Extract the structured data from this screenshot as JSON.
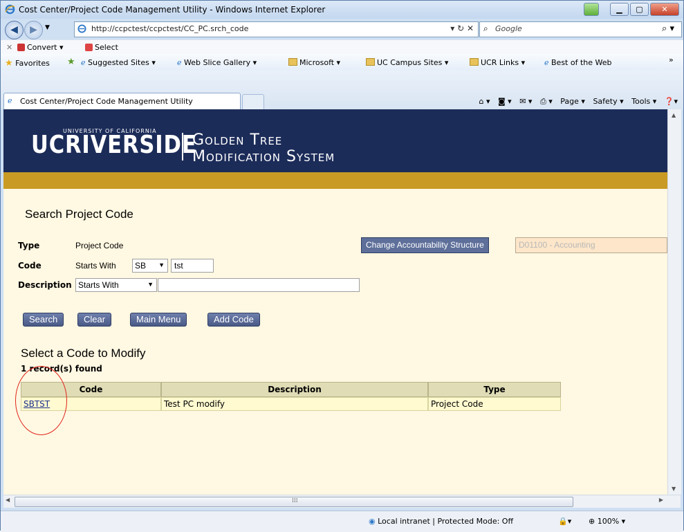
{
  "window": {
    "title": "Cost Center/Project Code Management Utility - Windows Internet Explorer"
  },
  "address_bar": {
    "url": "http://ccpctest/ccpctest/CC_PC.srch_code",
    "search_placeholder": "Google"
  },
  "toolbar": {
    "convert_label": "Convert ▾",
    "select_label": "Select"
  },
  "favorites": {
    "favorites_label": "Favorites",
    "items": [
      "Suggested Sites ▾",
      "Web Slice Gallery ▾",
      "Microsoft ▾",
      "UC Campus Sites ▾",
      "UCR Links ▾",
      "Best of the Web"
    ]
  },
  "tab": {
    "label": "Cost Center/Project Code Management Utility"
  },
  "command_bar": {
    "page_label": "Page ▾",
    "safety_label": "Safety ▾",
    "tools_label": "Tools ▾"
  },
  "banner": {
    "university_label": "UNIVERSITY OF CALIFORNIA",
    "logo_text": "UCRIVERSIDE",
    "system_line1": "Golden Tree",
    "system_line2": "Modification System"
  },
  "search_form": {
    "title": "Search Project Code",
    "type_label": "Type",
    "type_value": "Project Code",
    "code_label": "Code",
    "code_operator": "Starts With",
    "code_prefix": "SB",
    "code_value": "tst",
    "description_label": "Description",
    "description_operator": "Starts With",
    "description_value": "",
    "change_accountability_label": "Change Accountability Structure",
    "accountability_value": "D01100 - Accounting"
  },
  "buttons": {
    "search": "Search",
    "clear": "Clear",
    "main_menu": "Main Menu",
    "add_code": "Add Code"
  },
  "results": {
    "title": "Select a Code to Modify",
    "count_text": "1 record(s) found",
    "columns": [
      "Code",
      "Description",
      "Type"
    ],
    "rows": [
      {
        "code": "SBTST",
        "description": "Test PC modify",
        "type": "Project Code"
      }
    ]
  },
  "status_bar": {
    "zone_text": "Local intranet | Protected Mode: Off",
    "zoom_text": "100%"
  },
  "colors": {
    "banner_navy": "#1c2c59",
    "gold_bar": "#c99b25",
    "cream_bg": "#fff8e2",
    "button_blue": "#5e6f9a",
    "annotation_red": "#e0231b"
  }
}
